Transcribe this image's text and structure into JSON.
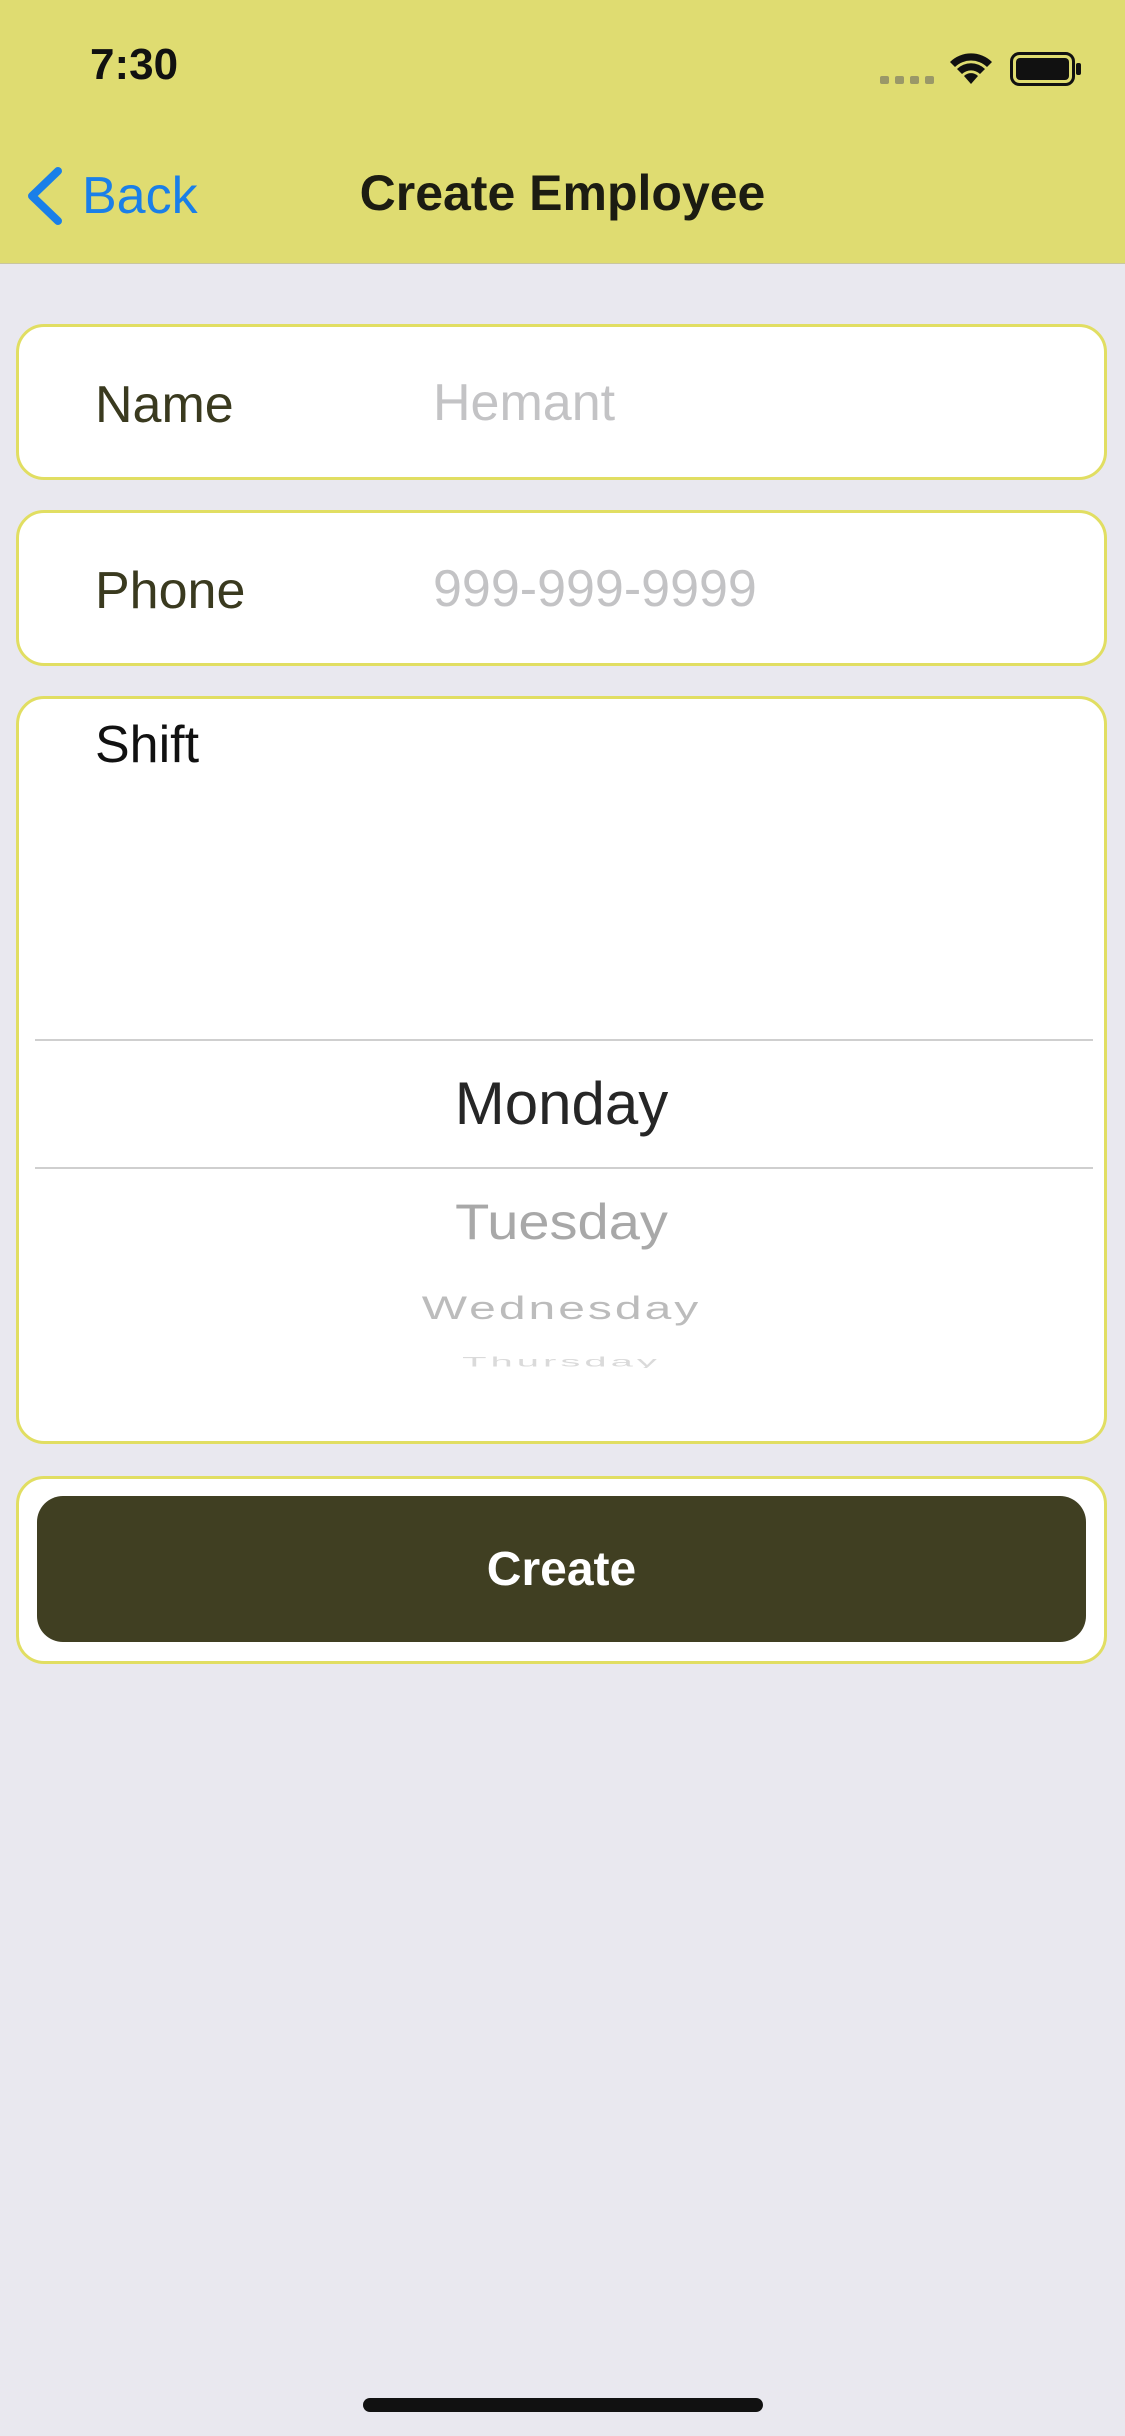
{
  "status_bar": {
    "time": "7:30",
    "icons": [
      "signal-icon",
      "wifi-icon",
      "battery-icon"
    ]
  },
  "nav": {
    "back_label": "Back",
    "title": "Create Employee",
    "background": "#dfdc71",
    "back_color": "#1a7fe8"
  },
  "form": {
    "name": {
      "label": "Name",
      "value": "",
      "placeholder": "Hemant"
    },
    "phone": {
      "label": "Phone",
      "value": "",
      "placeholder": "999-999-9999"
    },
    "shift": {
      "label": "Shift",
      "selected": "Monday",
      "options": [
        "Monday",
        "Tuesday",
        "Wednesday",
        "Thursday"
      ]
    },
    "submit_label": "Create"
  },
  "colors": {
    "card_border": "#e1de62",
    "button_bg": "#403f22",
    "page_bg": "#e9e8ef"
  }
}
